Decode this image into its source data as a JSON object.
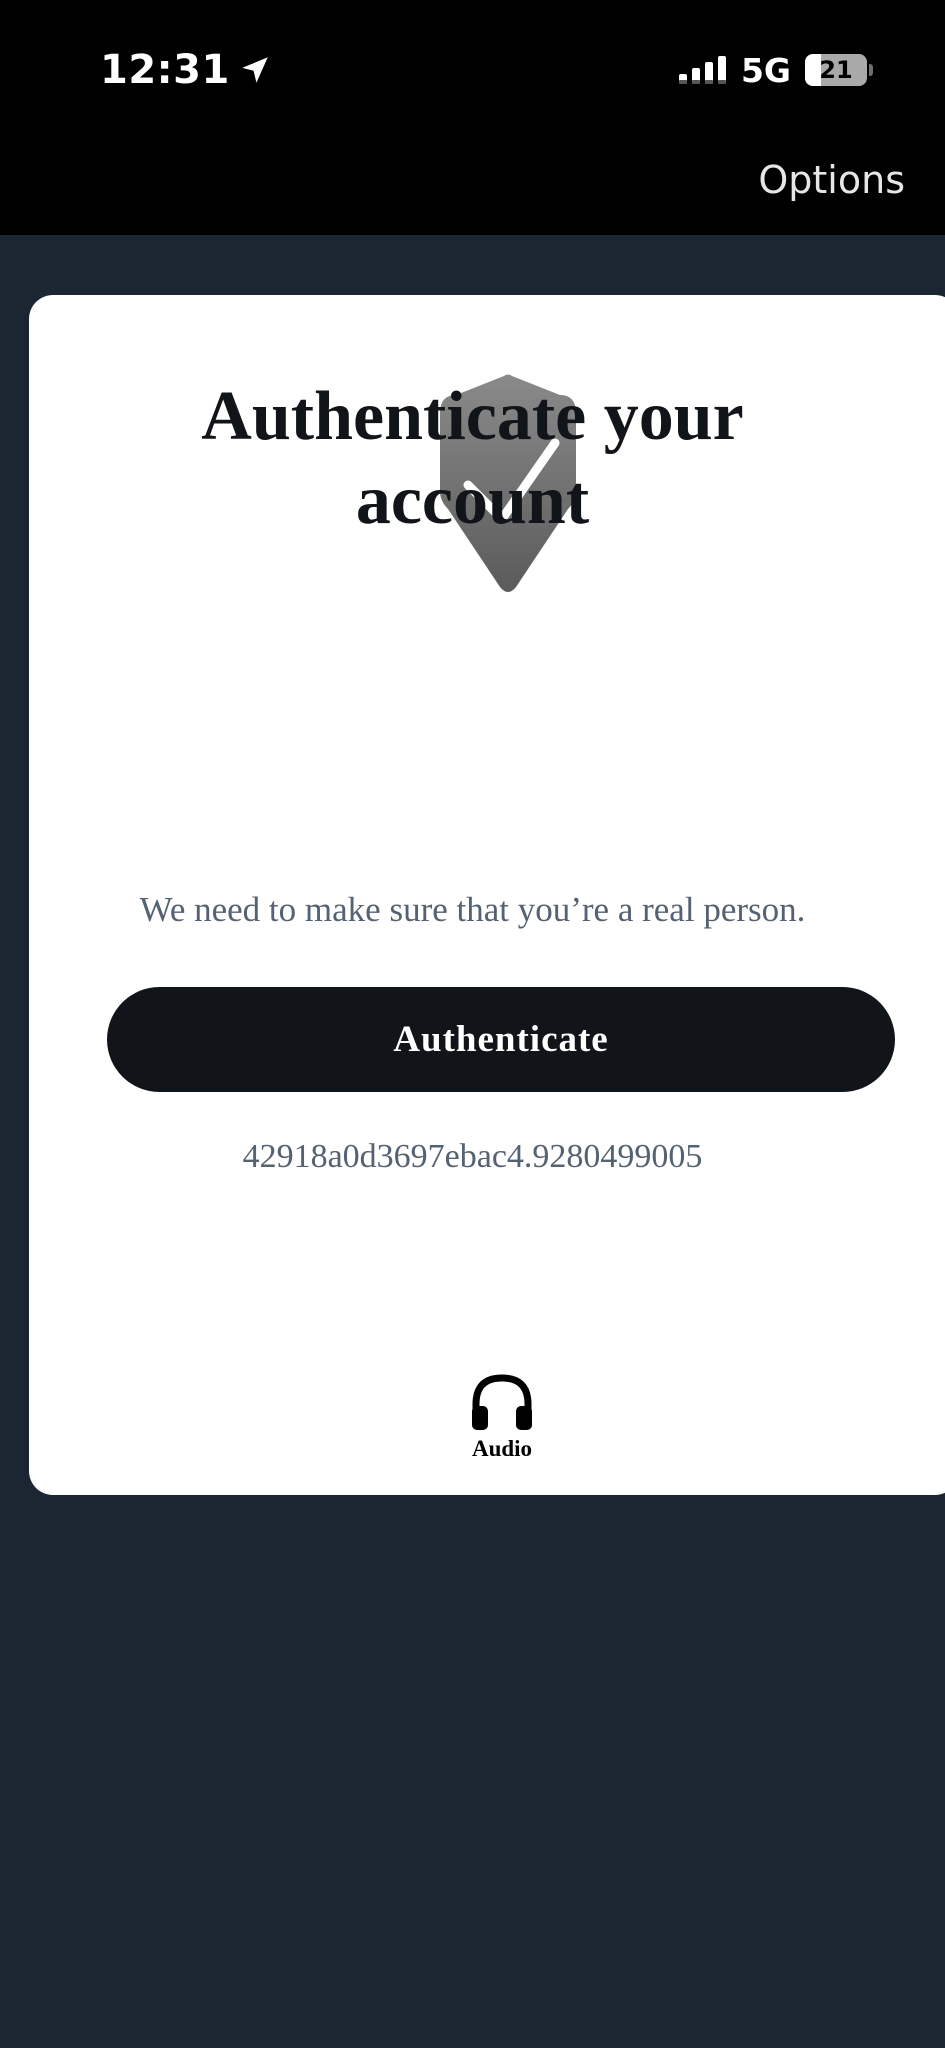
{
  "status_bar": {
    "time": "12:31",
    "network": "5G",
    "battery": "21"
  },
  "header": {
    "options_label": "Options"
  },
  "card": {
    "title": "Authenticate your\naccount",
    "subtitle": "We need to make sure that you’re a real person.",
    "button_label": "Authenticate",
    "token": "42918a0d3697ebac4.9280499005",
    "audio_label": "Audio"
  },
  "colors": {
    "page_background": "#1c2633",
    "topbar": "#000000",
    "card": "#ffffff",
    "button": "#111418",
    "muted_text": "#556272"
  },
  "icons": {
    "location": "location-arrow-icon",
    "signal": "cellular-signal-icon",
    "battery": "battery-icon",
    "shield": "shield-check-icon",
    "audio": "headphones-icon"
  }
}
